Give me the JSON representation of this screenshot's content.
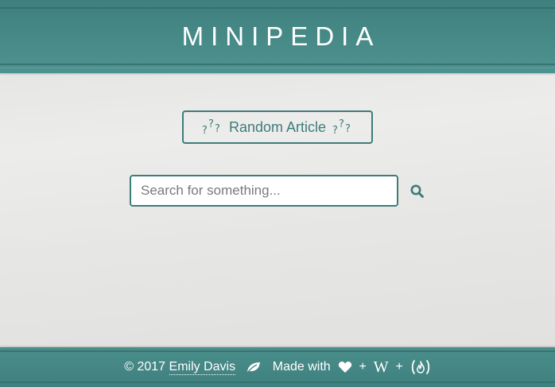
{
  "header": {
    "title": "MINIPEDIA"
  },
  "random_button": {
    "label": "Random Article",
    "icon": "question-marks-icon",
    "glyph": "?"
  },
  "search": {
    "placeholder": "Search for something...",
    "value": ""
  },
  "footer": {
    "copyright": "© 2017",
    "author": "Emily Davis",
    "made_with": "Made with",
    "plus": "+",
    "wiki_glyph": "W",
    "icons": [
      "leaf-icon",
      "heart-icon",
      "wikipedia-icon",
      "freecodecamp-icon"
    ]
  },
  "colors": {
    "header_bg": "#458885",
    "accent": "#3d7c7a",
    "page_bg": "#e6e6e5",
    "text_light": "#ffffff"
  }
}
